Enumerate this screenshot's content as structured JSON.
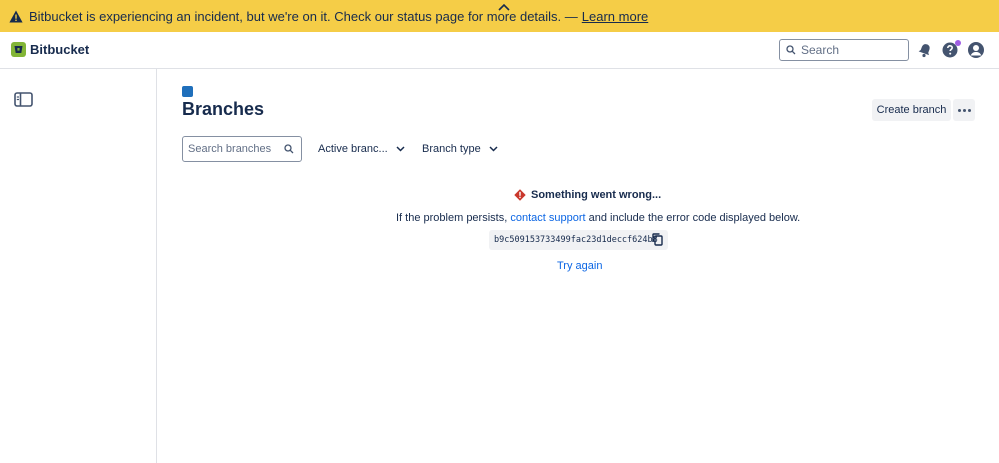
{
  "banner": {
    "message": "Bitbucket is experiencing an incident, but we're on it. Check our status page for more details. —",
    "link_label": "Learn more",
    "icon": "warning-icon",
    "background": "#f5cd47"
  },
  "topnav": {
    "product_name": "Bitbucket",
    "search_placeholder": "Search",
    "icons": [
      "bitbucket-logo-icon",
      "search-icon",
      "notifications-icon",
      "help-icon",
      "profile-icon"
    ],
    "help_dot_color": "#9f5ee3"
  },
  "sidebar": {
    "toggle_icon": "sidebar-toggle-icon"
  },
  "page": {
    "title": "Branches",
    "create_branch_label": "Create branch",
    "more_icon": "more-icon"
  },
  "filters": {
    "search_placeholder": "Search branches",
    "active_branches_label": "Active branc...",
    "branch_type_label": "Branch type"
  },
  "error": {
    "heading": "Something went wrong...",
    "body_prefix": "If the problem persists,",
    "contact_link": "contact support",
    "body_suffix": "and include the error code displayed below.",
    "code": "b9c509153733499fac23d1deccf624b8",
    "retry_label": "Try again",
    "accent": "#c9372c",
    "link_color": "#0c66e4"
  }
}
